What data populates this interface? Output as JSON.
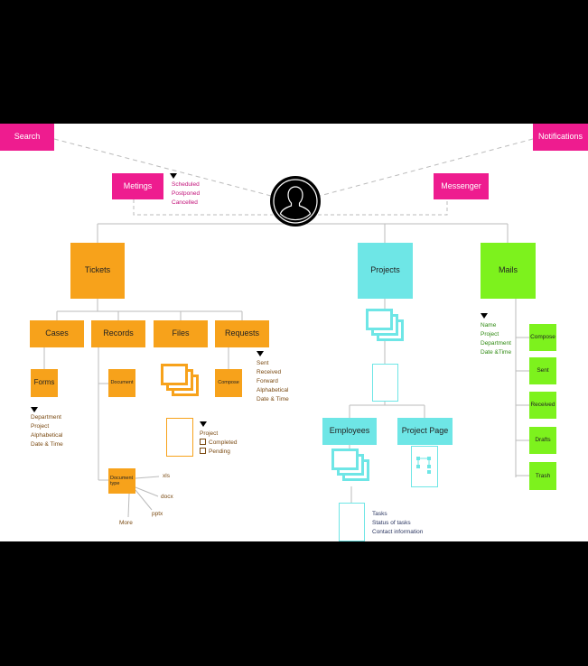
{
  "header": {
    "search_label": "Search",
    "notifications_label": "Notifications"
  },
  "top": {
    "meetings_label": "Metings",
    "meetings_filters": [
      "Scheduled",
      "Postponed",
      "Cancelled"
    ],
    "messenger_label": "Messenger",
    "user_icon": "user-silhouette-icon"
  },
  "tickets": {
    "label": "Tickets",
    "children": [
      "Cases",
      "Records",
      "Files",
      "Requests"
    ],
    "forms_label": "Forms",
    "forms_filters": [
      "Department",
      "Project",
      "Alphabetical",
      "Date & Time"
    ],
    "document_label": "Document",
    "document_type_label": "Document type",
    "doc_types": [
      "xls",
      "docx",
      "pptx",
      "More"
    ],
    "files_filters": [
      "Project",
      "Completed",
      "Pending"
    ],
    "compose_label": "Compose",
    "requests_filters": [
      "Sent",
      "Received",
      "Forward",
      "Alphabetical",
      "Date & Time"
    ]
  },
  "projects": {
    "label": "Projects",
    "employees_label": "Employees",
    "project_page_label": "Project Page",
    "employee_details": [
      "Tasks",
      "Status of tasks",
      "Contact information"
    ]
  },
  "mails": {
    "label": "Mails",
    "filters": [
      "Name",
      "Project",
      "Department",
      "Date &Time"
    ],
    "folders": [
      "Compose",
      "Sent",
      "Received",
      "Drafts",
      "Trash"
    ]
  },
  "colors": {
    "pink": "#ee1c8f",
    "orange": "#f7a21b",
    "cyan": "#6ee6e6",
    "green": "#7df21d"
  }
}
